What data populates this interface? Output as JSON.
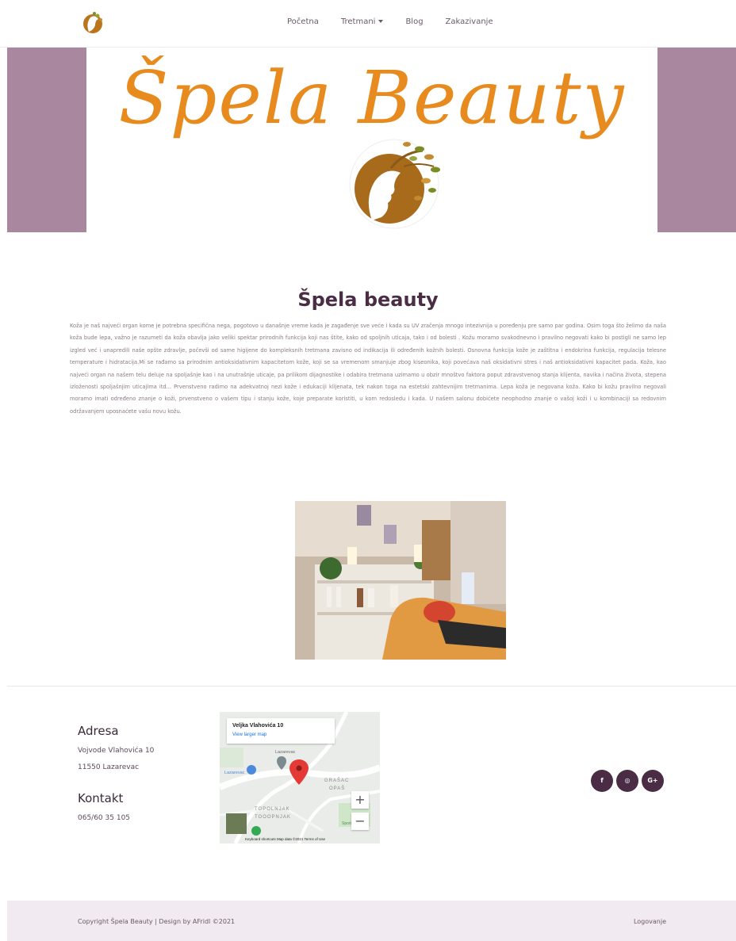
{
  "nav": {
    "items": [
      {
        "label": "Početna"
      },
      {
        "label": "Tretmani",
        "dropdown": true
      },
      {
        "label": "Blog"
      },
      {
        "label": "Zakazivanje"
      }
    ]
  },
  "hero": {
    "brand": "Špela Beauty"
  },
  "main": {
    "title": "Špela beauty",
    "intro": "Koža je naš najveći organ kome je potrebna specifična nega, pogotovo u današnje vreme kada je zagađenje sve veće i kada su UV zračenja mnogo intezivnija u poređenju pre samo par godina. Osim toga što želimo da naša koža bude lepa, važno je razumeti da koža obavlja jako veliki spektar prirodnih funkcija koji nas štite, kako od spoljnih uticaja, tako i od bolesti . Kožu moramo svakodnevno i pravilno negovati kako bi postigli ne samo lep izgled već i unapredili naše opšte zdravlje, počevši od same higijene do kompleksnih tretmana zavisno od indikacija ili određenih kožnih bolesti. Osnovna funkcija kože je zaštitna i endokrina funkcija, regulacija telesne temperature i hidratacija.Mi se rađamo sa prirodnim antioksidativnim kapacitetom kože, koji se sa vremenom smanjuje zbog kiseonika, koji povećava naš oksidativni stres i naš antioksidativni kapacitet pada. Koža, kao najveći organ na našem telu deluje na spoljašnje kao i na unutrašnje uticaje, pa prilikom dijagnostike i odabira tretmana uzimamo u obzir mnoštvo faktora poput zdravstvenog stanja klijenta, navika i načina života, stepena izloženosti spoljašnjim uticajima itd... Prvenstveno radimo na adekvatnoj nezi kože i edukaciji klijenata, tek nakon toga na estetski zahtevnijim tretmanima. Lepa koža je negovana koža. Kako bi kožu pravilno negovali moramo imati određeno znanje o koži, prvenstveno o vašem tipu i stanju kože, koje preparate koristiti, u kom redosledu i kada. U našem salonu dobićete neophodno znanje o vašoj koži i u kombinaciji sa redovnim održavanjem uposnaćete vašu novu kožu."
  },
  "footer_info": {
    "address_title": "Adresa",
    "address_line1": "Vojvode Vlahovića 10",
    "address_line2": "11550 Lazarevac",
    "contact_title": "Kontakt",
    "phone": "065/60 35 105"
  },
  "map": {
    "place": "Veljka Vlahovića 10",
    "link": "View larger map",
    "labels": [
      "Lazarevac",
      "GRAŠAC",
      "OPAŠ",
      "TOPOLNJAK",
      "TOOOPNJAK",
      "Sportski"
    ],
    "zoom_in": "+",
    "zoom_out": "−",
    "footer": "Keyboard shortcuts   Map data ©2021   Terms of Use"
  },
  "social": [
    {
      "label": "f",
      "icon": "facebook-icon"
    },
    {
      "label": "◎",
      "icon": "instagram-icon"
    },
    {
      "label": "G+",
      "icon": "google-plus-icon"
    }
  ],
  "footer": {
    "copyright": "Copyright Špela Beauty | Design by AFridl ©2021",
    "login": "Logovanje"
  },
  "colors": {
    "accent": "#4a2c45",
    "brand_orange": "#e88b1f",
    "hero_side": "#a8879f",
    "footer_bg": "#f1eaf0"
  }
}
